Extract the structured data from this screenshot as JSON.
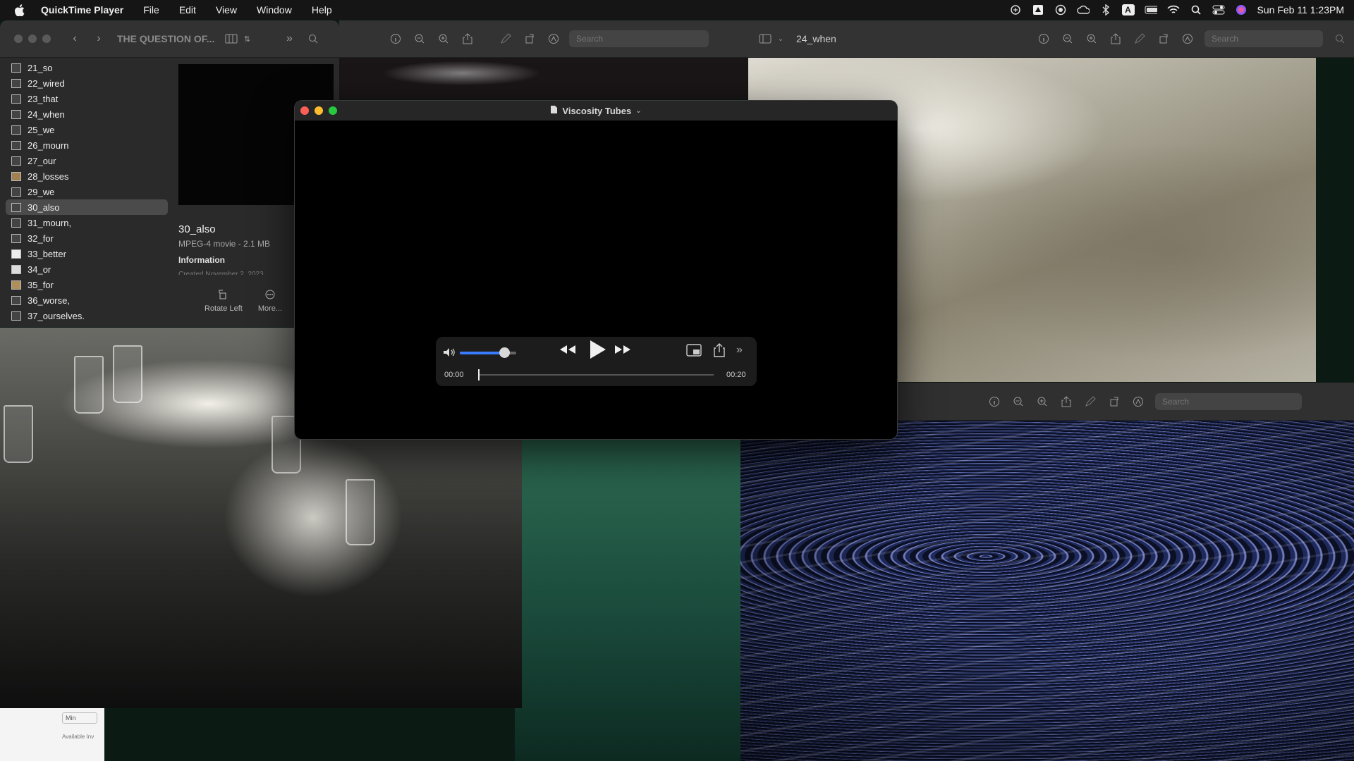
{
  "menubar": {
    "app_name": "QuickTime Player",
    "menus": [
      "File",
      "Edit",
      "View",
      "Window",
      "Help"
    ],
    "clock": "Sun Feb 11  1:23PM",
    "input_badge": "A"
  },
  "left_window": {
    "title": "THE QUESTION OF...",
    "sidebar_items": [
      {
        "label": "21_so"
      },
      {
        "label": "22_wired"
      },
      {
        "label": "23_that"
      },
      {
        "label": "24_when"
      },
      {
        "label": "25_we"
      },
      {
        "label": "26_mourn"
      },
      {
        "label": "27_our"
      },
      {
        "label": "28_losses"
      },
      {
        "label": "29_we"
      },
      {
        "label": "30_also",
        "selected": true
      },
      {
        "label": "31_mourn,"
      },
      {
        "label": "32_for"
      },
      {
        "label": "33_better"
      },
      {
        "label": "34_or"
      },
      {
        "label": "35_for"
      },
      {
        "label": "36_worse,"
      },
      {
        "label": "37_ourselves."
      }
    ],
    "file_name": "30_also",
    "file_meta": "MPEG-4 movie - 2.1 MB",
    "info_heading": "Information",
    "created_text": "Created   November 2, 2023",
    "actions": {
      "rotate_left": "Rotate Left",
      "more": "More..."
    }
  },
  "center_toolbar": {
    "search_placeholder": "Search"
  },
  "right_window": {
    "title": "24_when",
    "search_placeholder": "Search"
  },
  "blue_window": {
    "search_placeholder": "Search"
  },
  "quicktime": {
    "title": "Viscosity Tubes",
    "current_time": "00:00",
    "total_time": "00:20",
    "volume": 0.8,
    "progress": 0.0
  },
  "background_panel": {
    "button_label": "Min",
    "caption": "Available Inv"
  },
  "colors": {
    "accent": "#3b7bff",
    "close": "#fe5f57",
    "minimize": "#febc2e",
    "zoom": "#28c840"
  }
}
